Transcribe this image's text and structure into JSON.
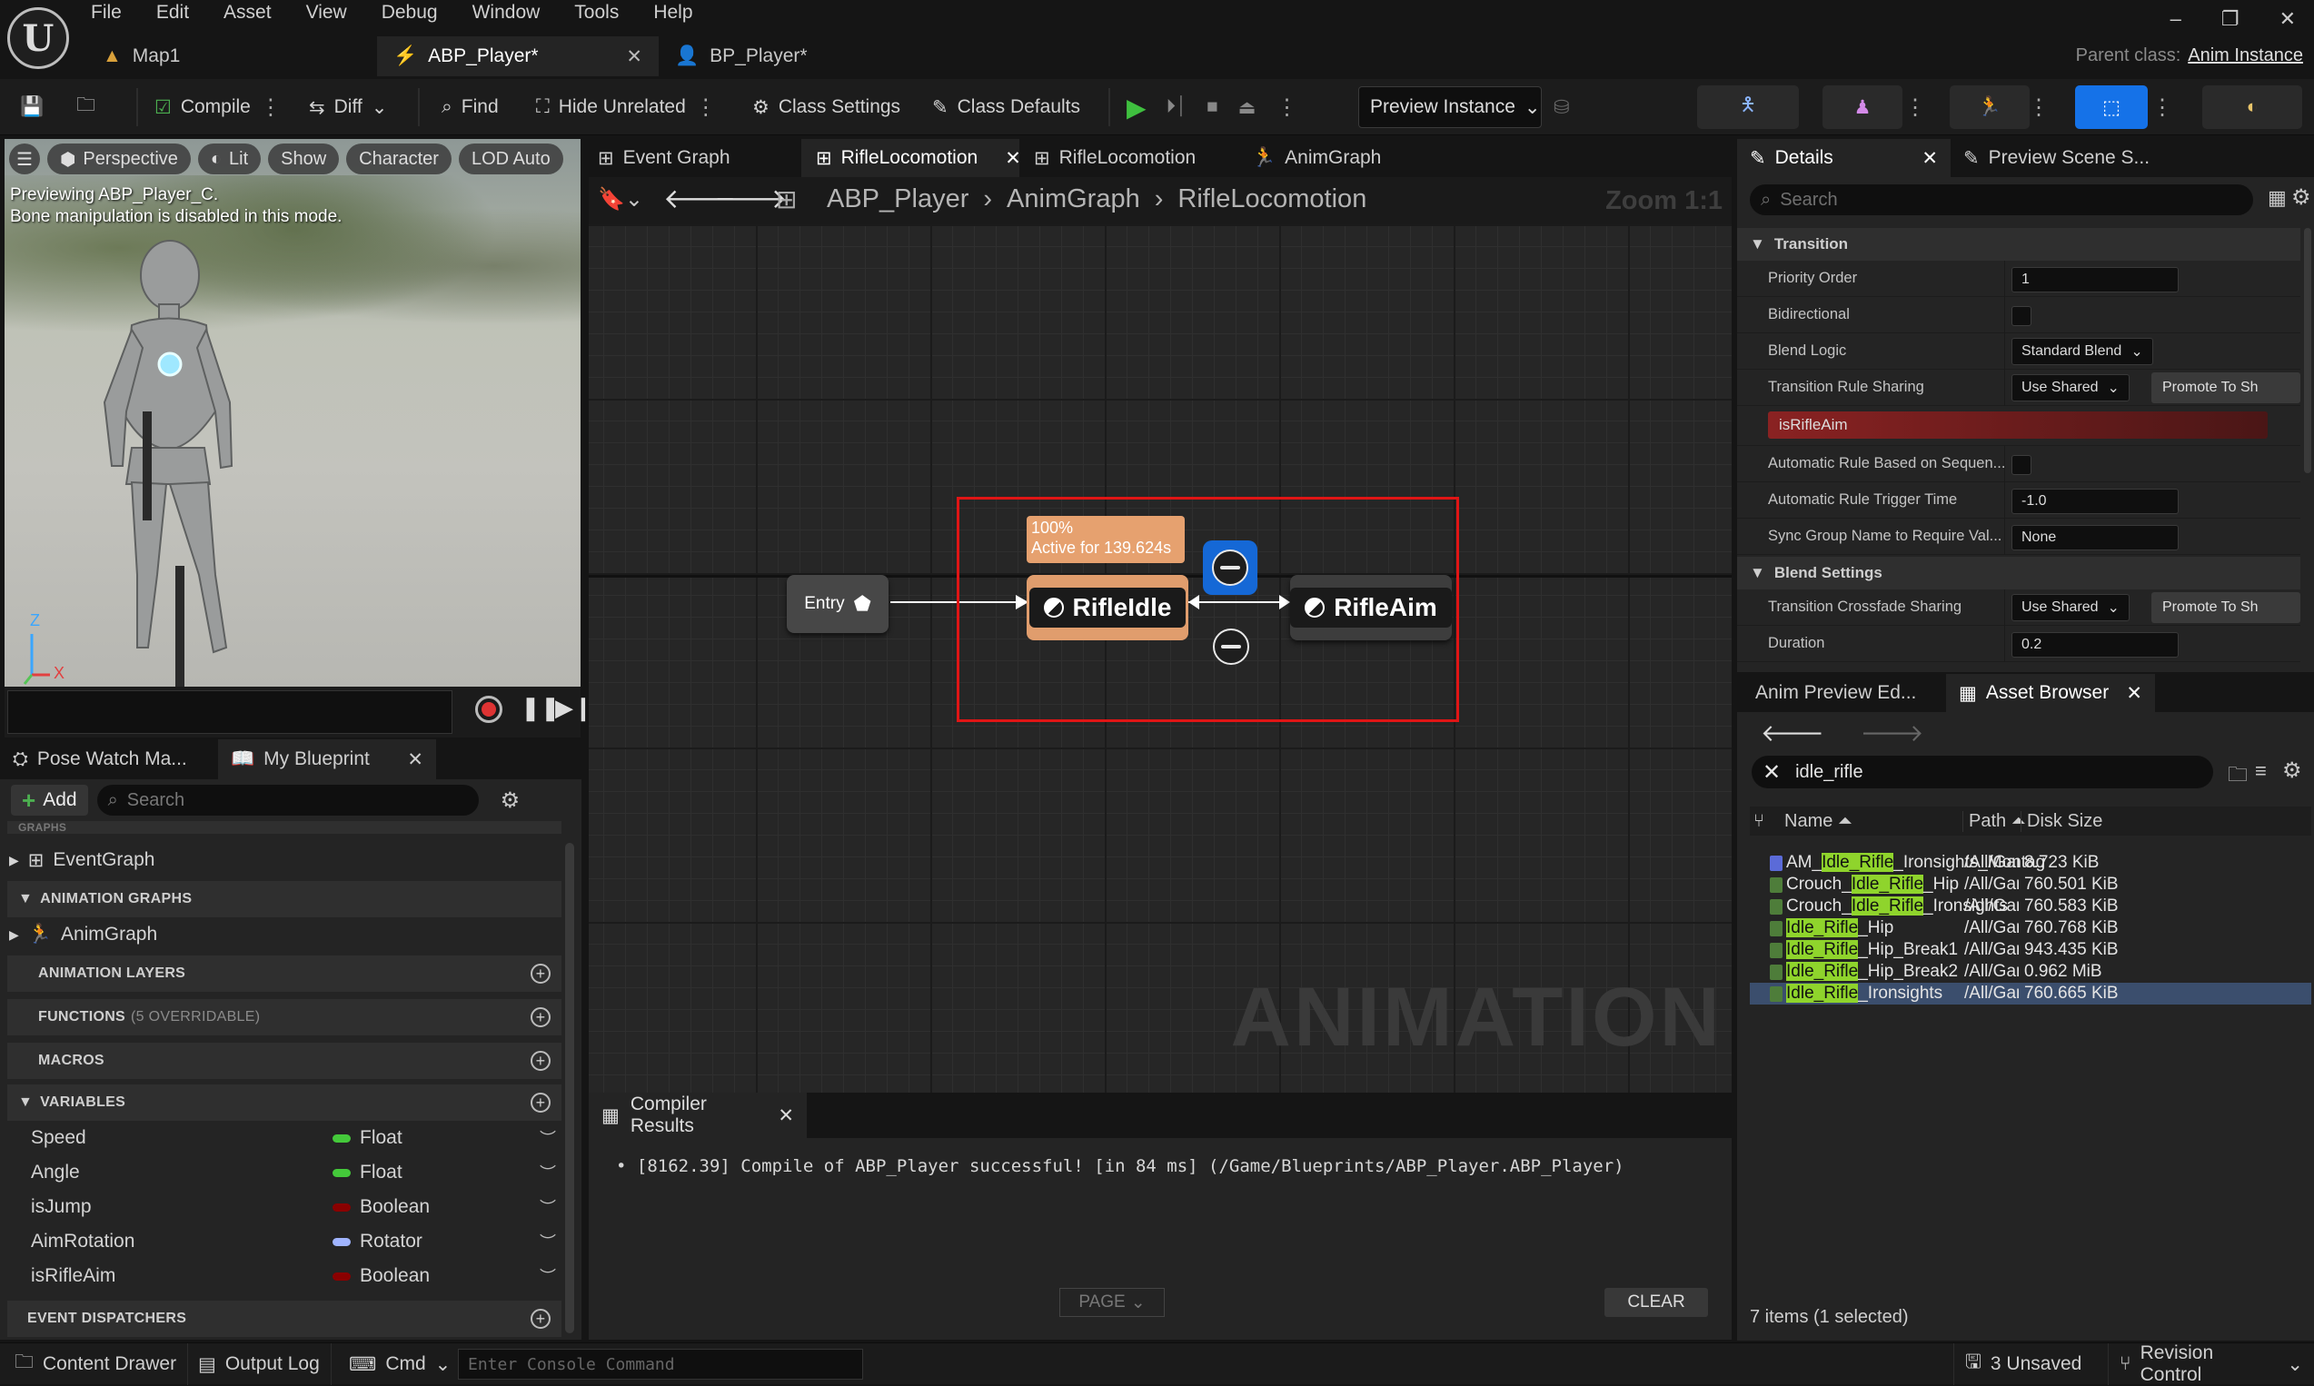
{
  "menu": [
    "File",
    "Edit",
    "Asset",
    "View",
    "Debug",
    "Window",
    "Tools",
    "Help"
  ],
  "doc_tabs": [
    {
      "label": "Map1",
      "active": false
    },
    {
      "label": "ABP_Player*",
      "active": true
    },
    {
      "label": "BP_Player*",
      "active": false
    }
  ],
  "parent_class": {
    "label": "Parent class:",
    "value": "Anim Instance"
  },
  "toolbar": {
    "compile": "Compile",
    "diff": "Diff",
    "find": "Find",
    "hide_unrelated": "Hide Unrelated",
    "class_settings": "Class Settings",
    "class_defaults": "Class Defaults",
    "preview_instance": "Preview Instance"
  },
  "viewport": {
    "buttons": [
      "Perspective",
      "Lit",
      "Show",
      "Character",
      "LOD Auto"
    ],
    "note_line1": "Previewing ABP_Player_C.",
    "note_line2": "Bone manipulation is disabled in this mode.",
    "axis_z": "Z",
    "axis_x": "X"
  },
  "left_tabs": [
    {
      "label": "Pose Watch Ma..."
    },
    {
      "label": "My Blueprint"
    }
  ],
  "my_blueprint": {
    "add": "Add",
    "search_placeholder": "Search",
    "graphs_header": "GRAPHS",
    "event_graph": "EventGraph",
    "anim_graphs_header": "ANIMATION GRAPHS",
    "anim_graph": "AnimGraph",
    "anim_layers": "ANIMATION LAYERS",
    "functions": "FUNCTIONS",
    "functions_sub": "(5 OVERRIDABLE)",
    "macros": "MACROS",
    "variables": "VARIABLES",
    "event_dispatchers": "EVENT DISPATCHERS",
    "vars": [
      {
        "name": "Speed",
        "type": "Float",
        "color": "#44c93a"
      },
      {
        "name": "Angle",
        "type": "Float",
        "color": "#44c93a"
      },
      {
        "name": "isJump",
        "type": "Boolean",
        "color": "#8a0000"
      },
      {
        "name": "AimRotation",
        "type": "Rotator",
        "color": "#a0b4ff"
      },
      {
        "name": "isRifleAim",
        "type": "Boolean",
        "color": "#8a0000"
      }
    ]
  },
  "graph_tabs": [
    {
      "label": "Event Graph"
    },
    {
      "label": "RifleLocomotion",
      "active": true
    },
    {
      "label": "RifleLocomotion"
    },
    {
      "label": "AnimGraph"
    }
  ],
  "breadcrumbs": [
    "ABP_Player",
    "AnimGraph",
    "RifleLocomotion"
  ],
  "zoom": "Zoom 1:1",
  "watermark": "ANIMATION",
  "nodes": {
    "entry": "Entry",
    "idle": "RifleIdle",
    "aim": "RifleAim",
    "active_pct": "100%",
    "active_time": "Active for 139.624s"
  },
  "compiler": {
    "tab": "Compiler Results",
    "message": "[8162.39] Compile of ABP_Player successful! [in 84 ms] (/Game/Blueprints/ABP_Player.ABP_Player)",
    "page": "PAGE",
    "clear": "CLEAR"
  },
  "details_tabs": [
    {
      "label": "Details"
    },
    {
      "label": "Preview Scene S..."
    }
  ],
  "details": {
    "search_placeholder": "Search",
    "transition_header": "Transition",
    "priority_order": {
      "label": "Priority Order",
      "value": "1"
    },
    "bidirectional": {
      "label": "Bidirectional"
    },
    "blend_logic": {
      "label": "Blend Logic",
      "value": "Standard Blend"
    },
    "rule_sharing": {
      "label": "Transition Rule Sharing",
      "value": "Use Shared",
      "promote": "Promote To Sh"
    },
    "rule_bar": "isRifleAim",
    "auto_rule": {
      "label": "Automatic Rule Based on Sequen..."
    },
    "auto_trigger": {
      "label": "Automatic Rule Trigger Time",
      "value": "-1.0"
    },
    "sync_group": {
      "label": "Sync Group Name to Require Val...",
      "value": "None"
    },
    "blend_header": "Blend Settings",
    "crossfade": {
      "label": "Transition Crossfade Sharing",
      "value": "Use Shared",
      "promote": "Promote To Sh"
    },
    "duration": {
      "label": "Duration",
      "value": "0.2"
    }
  },
  "asset_tabs": [
    {
      "label": "Anim Preview Ed..."
    },
    {
      "label": "Asset Browser"
    }
  ],
  "assets": {
    "search": "idle_rifle",
    "col_name": "Name",
    "col_path": "Path",
    "col_size": "Disk Size",
    "rows": [
      {
        "pre": "AM_",
        "hl": "Idle_Rifle",
        "post": "_Ironsights_Montag",
        "path": "/All/Game/",
        "size": "8.723 KiB",
        "icon": "#5b6bd8",
        "sel": false
      },
      {
        "pre": "Crouch_",
        "hl": "Idle_Rifle",
        "post": "_Hip",
        "path": "/All/Game/",
        "size": "760.501 KiB",
        "icon": "#4e7d3a",
        "sel": false
      },
      {
        "pre": "Crouch_",
        "hl": "Idle_Rifle",
        "post": "_Ironsights",
        "path": "/All/Game/",
        "size": "760.583 KiB",
        "icon": "#4e7d3a",
        "sel": false
      },
      {
        "pre": "",
        "hl": "Idle_Rifle",
        "post": "_Hip",
        "path": "/All/Game/",
        "size": "760.768 KiB",
        "icon": "#4e7d3a",
        "sel": false
      },
      {
        "pre": "",
        "hl": "Idle_Rifle",
        "post": "_Hip_Break1",
        "path": "/All/Game/",
        "size": "943.435 KiB",
        "icon": "#4e7d3a",
        "sel": false
      },
      {
        "pre": "",
        "hl": "Idle_Rifle",
        "post": "_Hip_Break2",
        "path": "/All/Game/",
        "size": "0.962 MiB",
        "icon": "#4e7d3a",
        "sel": false
      },
      {
        "pre": "",
        "hl": "Idle_Rifle",
        "post": "_Ironsights",
        "path": "/All/Game/",
        "size": "760.665 KiB",
        "icon": "#4e7d3a",
        "sel": true
      }
    ],
    "count": "7 items (1 selected)"
  },
  "status": {
    "content_drawer": "Content Drawer",
    "output_log": "Output Log",
    "cmd": "Cmd",
    "console_placeholder": "Enter Console Command",
    "unsaved": "3 Unsaved",
    "revision": "Revision Control"
  }
}
